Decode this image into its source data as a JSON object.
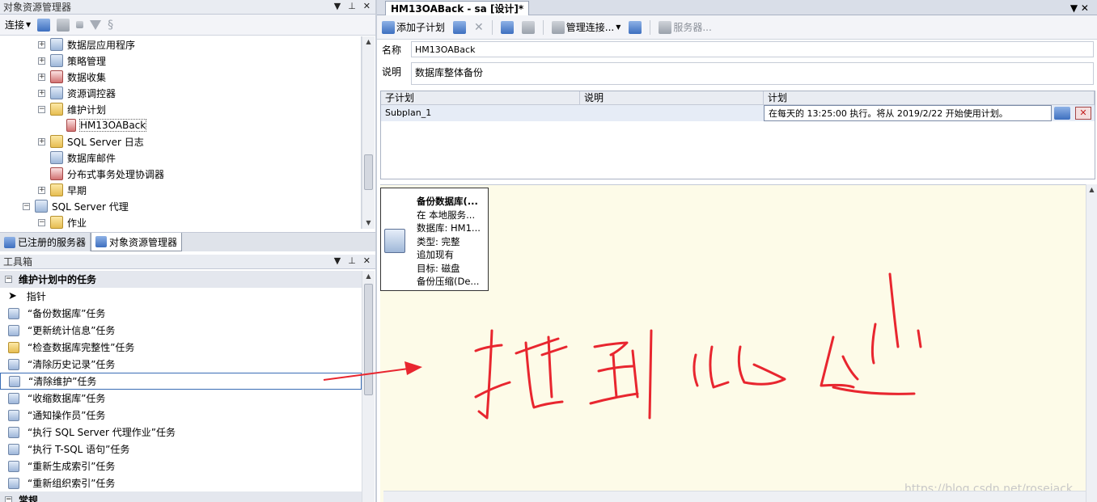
{
  "left_panel": {
    "title": "对象资源管理器",
    "toolbar": {
      "connect_label": "连接"
    },
    "tree": [
      {
        "label": "数据层应用程序",
        "icon": "app-icon",
        "toggle": "+"
      },
      {
        "label": "策略管理",
        "icon": "policy-icon",
        "toggle": "+"
      },
      {
        "label": "数据收集",
        "icon": "chart-icon",
        "toggle": "+"
      },
      {
        "label": "资源调控器",
        "icon": "resource-icon",
        "toggle": "+"
      },
      {
        "label": "维护计划",
        "icon": "folder-icon",
        "toggle": "−"
      },
      {
        "label": "HM13OABack",
        "icon": "plan-icon",
        "toggle": ""
      },
      {
        "label": "SQL Server 日志",
        "icon": "folder-icon",
        "toggle": "+"
      },
      {
        "label": "数据库邮件",
        "icon": "mail-icon",
        "toggle": ""
      },
      {
        "label": "分布式事务处理协调器",
        "icon": "dtc-icon",
        "toggle": ""
      },
      {
        "label": "早期",
        "icon": "folder-icon",
        "toggle": "+"
      },
      {
        "label": "SQL Server 代理",
        "icon": "agent-icon",
        "toggle": "−"
      },
      {
        "label": "作业",
        "icon": "folder-icon",
        "toggle": "−"
      }
    ],
    "tabs": [
      {
        "label": "已注册的服务器",
        "active": false
      },
      {
        "label": "对象资源管理器",
        "active": true
      }
    ]
  },
  "toolbox": {
    "title": "工具箱",
    "groups": [
      {
        "label": "维护计划中的任务",
        "items": [
          {
            "label": "指针",
            "icon": "pointer-icon"
          },
          {
            "label": "“备份数据库”任务",
            "icon": "backup-db-icon"
          },
          {
            "label": "“更新统计信息”任务",
            "icon": "update-stats-icon"
          },
          {
            "label": "“检查数据库完整性”任务",
            "icon": "check-integrity-icon"
          },
          {
            "label": "“清除历史记录”任务",
            "icon": "cleanup-history-icon"
          },
          {
            "label": "“清除维护”任务",
            "icon": "cleanup-maintenance-icon",
            "selected": true
          },
          {
            "label": "“收缩数据库”任务",
            "icon": "shrink-db-icon"
          },
          {
            "label": "“通知操作员”任务",
            "icon": "notify-operator-icon"
          },
          {
            "label": "“执行 SQL Server 代理作业”任务",
            "icon": "agent-job-icon"
          },
          {
            "label": "“执行 T-SQL 语句”任务",
            "icon": "tsql-icon"
          },
          {
            "label": "“重新生成索引”任务",
            "icon": "rebuild-index-icon"
          },
          {
            "label": "“重新组织索引”任务",
            "icon": "reorganize-index-icon"
          }
        ]
      },
      {
        "label": "常规",
        "items": []
      }
    ]
  },
  "document": {
    "tab_title": "HM13OABack - sa [设计]*",
    "toolbar": {
      "add_subplan": "添加子计划",
      "manage_connections": "管理连接...",
      "servers": "服务器..."
    },
    "name_label": "名称",
    "name_value": "HM13OABack",
    "desc_label": "说明",
    "desc_value": "数据库整体备份",
    "grid": {
      "headers": [
        "子计划",
        "说明",
        "计划"
      ],
      "rows": [
        {
          "subplan": "Subplan_1",
          "description": "",
          "schedule": "在每天的 13:25:00 执行。将从 2019/2/22 开始使用计划。"
        }
      ]
    },
    "task_box": {
      "lines": [
        "备份数据库(...",
        "在 本地服务...",
        "数据库: HM1...",
        "类型: 完整",
        "追加现有",
        "目标: 磁盘",
        "备份压缩(De..."
      ]
    },
    "annotation_text": "拖到此处",
    "annotation_color": "#e8262f",
    "watermark": "https://blog.csdn.net/rosejack"
  }
}
